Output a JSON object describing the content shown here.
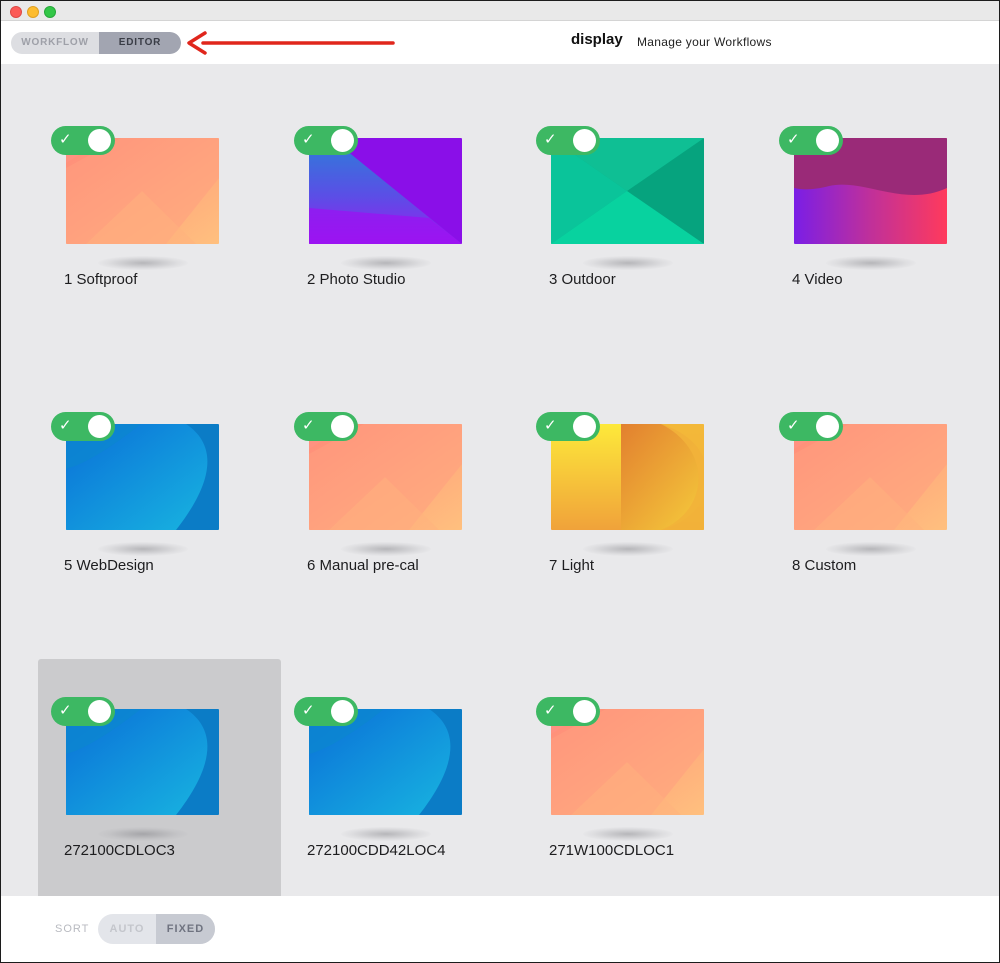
{
  "header": {
    "mode_options": [
      "WORKFLOW",
      "EDITOR"
    ],
    "active_mode": "EDITOR",
    "app_name": "display",
    "subtitle": "Manage your Workflows"
  },
  "workflows": [
    {
      "label": "1 Softproof",
      "enabled": true,
      "thumbnail": "peach-diamond",
      "selected": false
    },
    {
      "label": "2 Photo Studio",
      "enabled": true,
      "thumbnail": "purple-blue-triangle",
      "selected": false
    },
    {
      "label": "3 Outdoor",
      "enabled": true,
      "thumbnail": "green-envelope",
      "selected": false
    },
    {
      "label": "4 Video",
      "enabled": true,
      "thumbnail": "magenta-wave",
      "selected": false
    },
    {
      "label": "5 WebDesign",
      "enabled": true,
      "thumbnail": "blue-curve",
      "selected": false
    },
    {
      "label": "6 Manual pre-cal",
      "enabled": true,
      "thumbnail": "peach-diamond",
      "selected": false
    },
    {
      "label": "7 Light",
      "enabled": true,
      "thumbnail": "yellow-d",
      "selected": false
    },
    {
      "label": "8 Custom",
      "enabled": true,
      "thumbnail": "peach-diamond",
      "selected": false
    },
    {
      "label": "272100CDLOC3",
      "enabled": true,
      "thumbnail": "blue-curve",
      "selected": true
    },
    {
      "label": "272100CDD42LOC4",
      "enabled": true,
      "thumbnail": "blue-curve",
      "selected": false
    },
    {
      "label": "271W100CDLOC1",
      "enabled": true,
      "thumbnail": "peach-diamond",
      "selected": false
    }
  ],
  "toggle_check_glyph": "✓",
  "footer": {
    "sort_label": "SORT",
    "sort_options": [
      "AUTO",
      "FIXED"
    ],
    "active_sort": "FIXED"
  },
  "colors": {
    "toggle_on": "#3db863",
    "annotation_arrow": "#e0261c",
    "content_bg": "#e9e9eb",
    "selected_card": "#cbcbcd"
  }
}
